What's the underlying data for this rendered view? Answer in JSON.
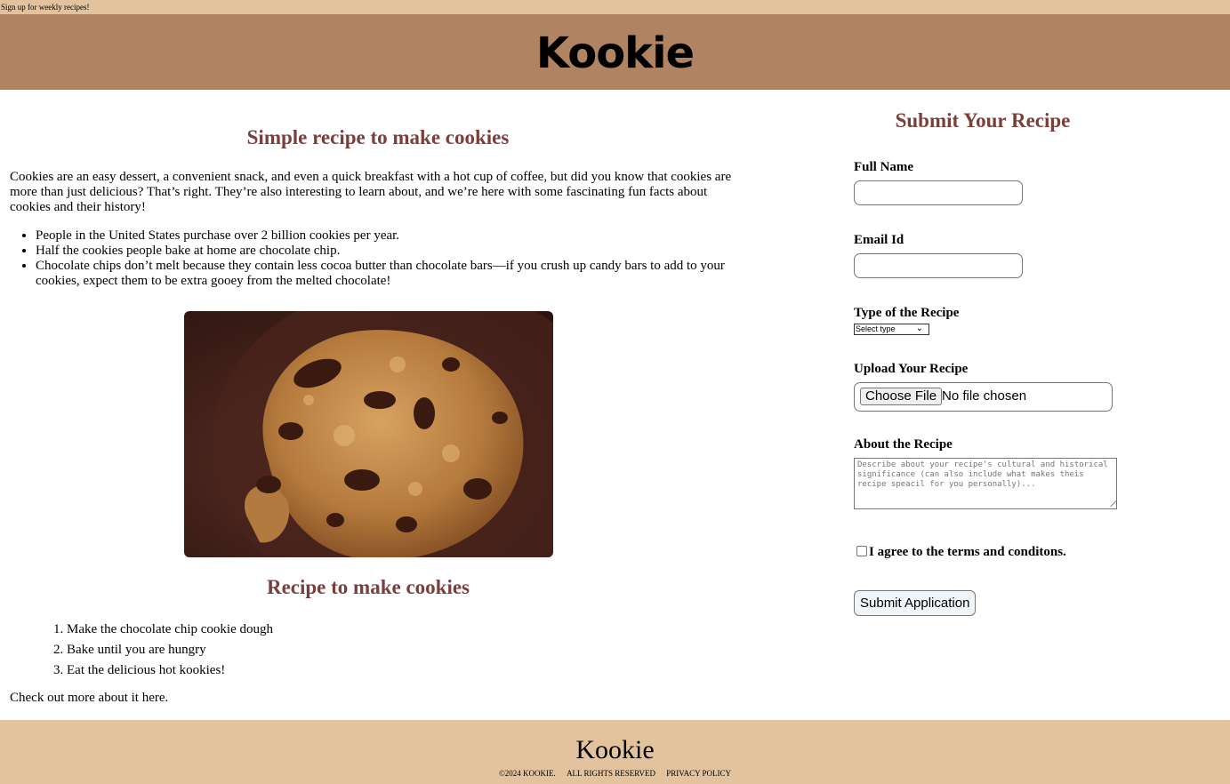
{
  "topbar": {
    "text": "Sign up for weekly recipes!"
  },
  "header": {
    "brand": "Kookie"
  },
  "article": {
    "title": "Simple recipe to make cookies",
    "intro": "Cookies are an easy dessert, a convenient snack, and even a quick breakfast with a hot cup of coffee, but did you know that cookies are more than just delicious? That’s right. They’re also interesting to learn about, and we’re here with some fascinating fun facts about cookies and their history!",
    "facts": [
      "People in the United States purchase over 2 billion cookies per year.",
      "Half the cookies people bake at home are chocolate chip.",
      "Chocolate chips don’t melt because they contain less cocoa butter than chocolate bars—if you crush up candy bars to add to your cookies, expect them to be extra gooey from the melted chocolate!"
    ],
    "recipe_title": "Recipe to make cookies",
    "steps": [
      "Make the chocolate chip cookie dough",
      "Bake until you are hungry",
      "Eat the delicious hot kookies!"
    ],
    "more_text": "Check out more about it here."
  },
  "form": {
    "title": "Submit Your Recipe",
    "full_name_label": "Full Name",
    "full_name_value": "",
    "email_label": "Email Id",
    "email_value": "",
    "type_label": "Type of the Recipe",
    "type_selected": "Select type",
    "upload_label": "Upload Your Recipe",
    "upload_button": "Choose File",
    "upload_status": "No file chosen",
    "about_label": "About the Recipe",
    "about_placeholder": "Describe about your recipe's cultural and historical significance (can also include what makes theis recipe speacil for you personally)...",
    "agree_label": "I agree to the terms and conditons.",
    "submit_label": "Submit Application"
  },
  "footer": {
    "brand": "Kookie",
    "copyright": "©2024 KOOKIE.",
    "rights": "ALL RIGHTS RESERVED",
    "privacy": "PRIVACY POLICY"
  },
  "colors": {
    "topbar": "#e3c39d",
    "header": "#b08462",
    "heading": "#7b3f3b",
    "footer": "#e3c39d"
  }
}
